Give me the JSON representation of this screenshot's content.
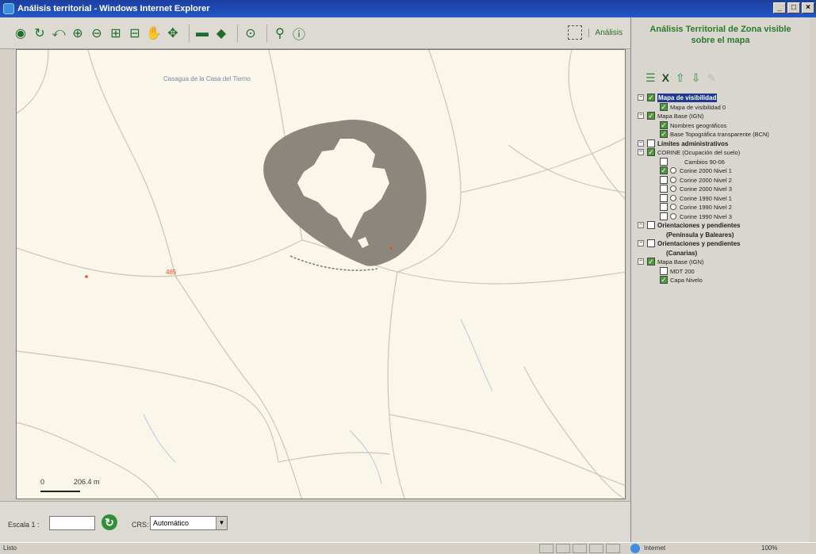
{
  "window": {
    "title": "Análisis territorial - Windows Internet Explorer",
    "min": "_",
    "max": "□",
    "close": "×"
  },
  "toolbar": {
    "tools": [
      {
        "icon": "full-extent-icon",
        "glyph": "◉"
      },
      {
        "icon": "refresh-map-icon",
        "glyph": "↻"
      },
      {
        "icon": "zoom-previous-icon",
        "glyph": "⤺"
      },
      {
        "icon": "zoom-in-icon",
        "glyph": "⊕"
      },
      {
        "icon": "zoom-out-icon",
        "glyph": "⊖"
      },
      {
        "icon": "zoom-box-icon",
        "glyph": "⊞"
      },
      {
        "icon": "zoom-window-icon",
        "glyph": "⊟"
      },
      {
        "icon": "pan-hand-icon",
        "glyph": "✋"
      },
      {
        "icon": "center-map-icon",
        "glyph": "✥"
      },
      {
        "icon": "measure-distance-icon",
        "glyph": "▬"
      },
      {
        "icon": "measure-area-icon",
        "glyph": "◆"
      },
      {
        "icon": "identify-icon",
        "glyph": "⊙"
      },
      {
        "icon": "search-binoculars-icon",
        "glyph": "⚲"
      },
      {
        "icon": "info-icon",
        "glyph": "ⓘ"
      }
    ],
    "analisis_label": "Análisis"
  },
  "map": {
    "place_label": "Casagua de la Casa del Tierno",
    "marker_label": "485",
    "scale_zero": "0",
    "scale_distance": "206.4 m",
    "colors": {
      "background": "#faf6ea",
      "visibility_area": "#8c877d",
      "roads": "#c9c3b6"
    }
  },
  "bottom": {
    "escala_label": "Escala 1 :",
    "escala_value": "",
    "crs_label": "CRS:",
    "crs_value": "Automático"
  },
  "sidebar": {
    "title": "Análisis Territorial de Zona visible sobre el mapa",
    "layer_tools": [
      "list-icon",
      "delete-x-icon",
      "move-up-icon",
      "move-down-icon",
      "eraser-icon"
    ],
    "layers": [
      {
        "label": "Mapa de visibilidad",
        "level": 0,
        "expander": true,
        "checked": true,
        "bold": true,
        "selected": true
      },
      {
        "label": "Mapa de visibilidad 0",
        "level": 1,
        "checked": true
      },
      {
        "label": "Mapa Base (IGN)",
        "level": 0,
        "expander": true,
        "checked": true
      },
      {
        "label": "Nombres geográficos",
        "level": 1,
        "checked": true
      },
      {
        "label": "Base Topográfica transparente (BCN)",
        "level": 1,
        "checked": true
      },
      {
        "label": "Límites administrativos",
        "level": 0,
        "expander": true,
        "checked": false,
        "bold": true
      },
      {
        "label": "CORINE (Ocupación del suelo)",
        "level": 0,
        "expander": true,
        "checked": true
      },
      {
        "label": "Cambios 90-06",
        "level": 1,
        "checked": false
      },
      {
        "label": "Corine 2000 Nivel 1",
        "level": 1,
        "checked": true,
        "radio": true
      },
      {
        "label": "Corine 2000 Nivel 2",
        "level": 1,
        "checked": false,
        "radio": true
      },
      {
        "label": "Corine 2000 Nivel 3",
        "level": 1,
        "checked": false,
        "radio": true
      },
      {
        "label": "Corine 1990 Nivel 1",
        "level": 1,
        "checked": false,
        "radio": true
      },
      {
        "label": "Corine 1990 Nivel 2",
        "level": 1,
        "checked": false,
        "radio": true
      },
      {
        "label": "Corine 1990 Nivel 3",
        "level": 1,
        "checked": false,
        "radio": true
      },
      {
        "label": "Orientaciones y pendientes",
        "level": 0,
        "expander": true,
        "checked": false,
        "bold": true
      },
      {
        "label": "(Península y Baleares)",
        "level": 2,
        "bold": true
      },
      {
        "label": "Orientaciones y pendientes",
        "level": 0,
        "expander": true,
        "checked": false,
        "bold": true
      },
      {
        "label": "(Canarias)",
        "level": 2,
        "bold": true
      },
      {
        "label": "Mapa Base (IGN)",
        "level": 0,
        "expander": true,
        "checked": true
      },
      {
        "label": "MDT 200",
        "level": 1,
        "checked": false
      },
      {
        "label": "Capa Nivelo",
        "level": 1,
        "checked": true
      }
    ]
  },
  "status": {
    "text": "Listo",
    "zone": "Internet",
    "zoom": "100%"
  }
}
